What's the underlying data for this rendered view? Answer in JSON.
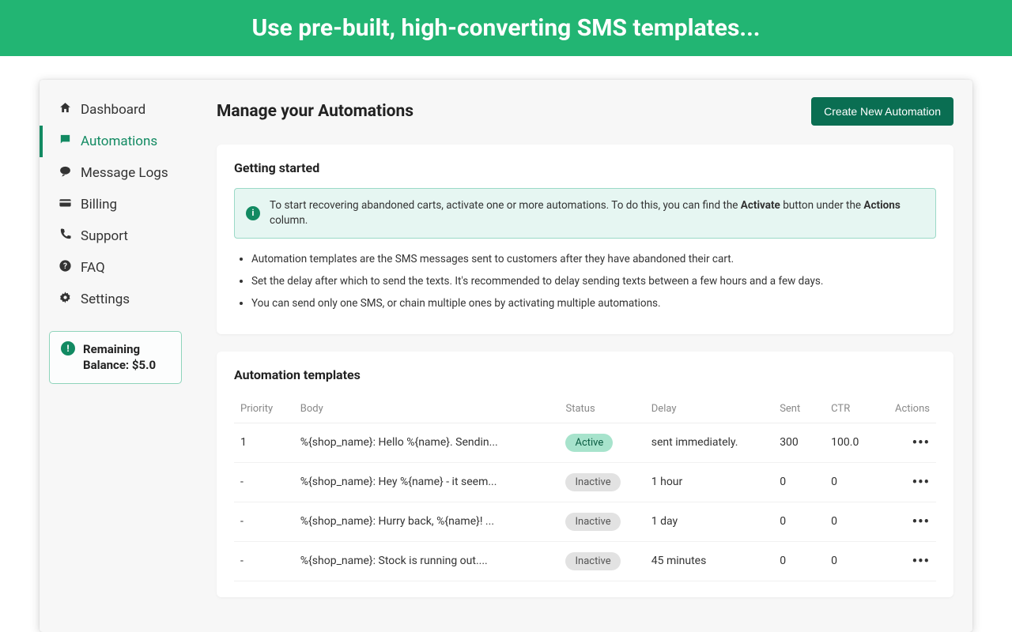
{
  "banner": {
    "text": "Use pre-built, high-converting SMS templates..."
  },
  "sidebar": {
    "items": [
      {
        "label": "Dashboard",
        "icon": "home"
      },
      {
        "label": "Automations",
        "icon": "chat",
        "active": true
      },
      {
        "label": "Message Logs",
        "icon": "sms"
      },
      {
        "label": "Billing",
        "icon": "card"
      },
      {
        "label": "Support",
        "icon": "phone"
      },
      {
        "label": "FAQ",
        "icon": "help"
      },
      {
        "label": "Settings",
        "icon": "gear"
      }
    ],
    "balance": {
      "label": "Remaining Balance: $5.0"
    }
  },
  "main": {
    "title": "Manage your Automations",
    "create_button": "Create New Automation",
    "getting_started": {
      "title": "Getting started",
      "info_prefix": "To start recovering abandoned carts, activate one or more automations. To do this, you can find the ",
      "info_bold1": "Activate",
      "info_mid": " button under the ",
      "info_bold2": "Actions",
      "info_suffix": " column.",
      "bullets": [
        "Automation templates are the SMS messages sent to customers after they have abandoned their cart.",
        "Set the delay after which to send the texts. It's recommended to delay sending texts between a few hours and a few days.",
        "You can send only one SMS, or chain multiple ones by activating multiple automations."
      ]
    },
    "templates": {
      "title": "Automation templates",
      "columns": {
        "priority": "Priority",
        "body": "Body",
        "status": "Status",
        "delay": "Delay",
        "sent": "Sent",
        "ctr": "CTR",
        "actions": "Actions"
      },
      "rows": [
        {
          "priority": "1",
          "body": "%{shop_name}: Hello %{name}. Sendin...",
          "status": "Active",
          "delay": "sent immediately.",
          "sent": "300",
          "ctr": "100.0"
        },
        {
          "priority": "-",
          "body": "%{shop_name}: Hey %{name} - it seem...",
          "status": "Inactive",
          "delay": "1 hour",
          "sent": "0",
          "ctr": "0"
        },
        {
          "priority": "-",
          "body": "%{shop_name}: Hurry back, %{name}! ...",
          "status": "Inactive",
          "delay": "1 day",
          "sent": "0",
          "ctr": "0"
        },
        {
          "priority": "-",
          "body": "%{shop_name}: Stock is running out....",
          "status": "Inactive",
          "delay": "45 minutes",
          "sent": "0",
          "ctr": "0"
        }
      ]
    }
  }
}
